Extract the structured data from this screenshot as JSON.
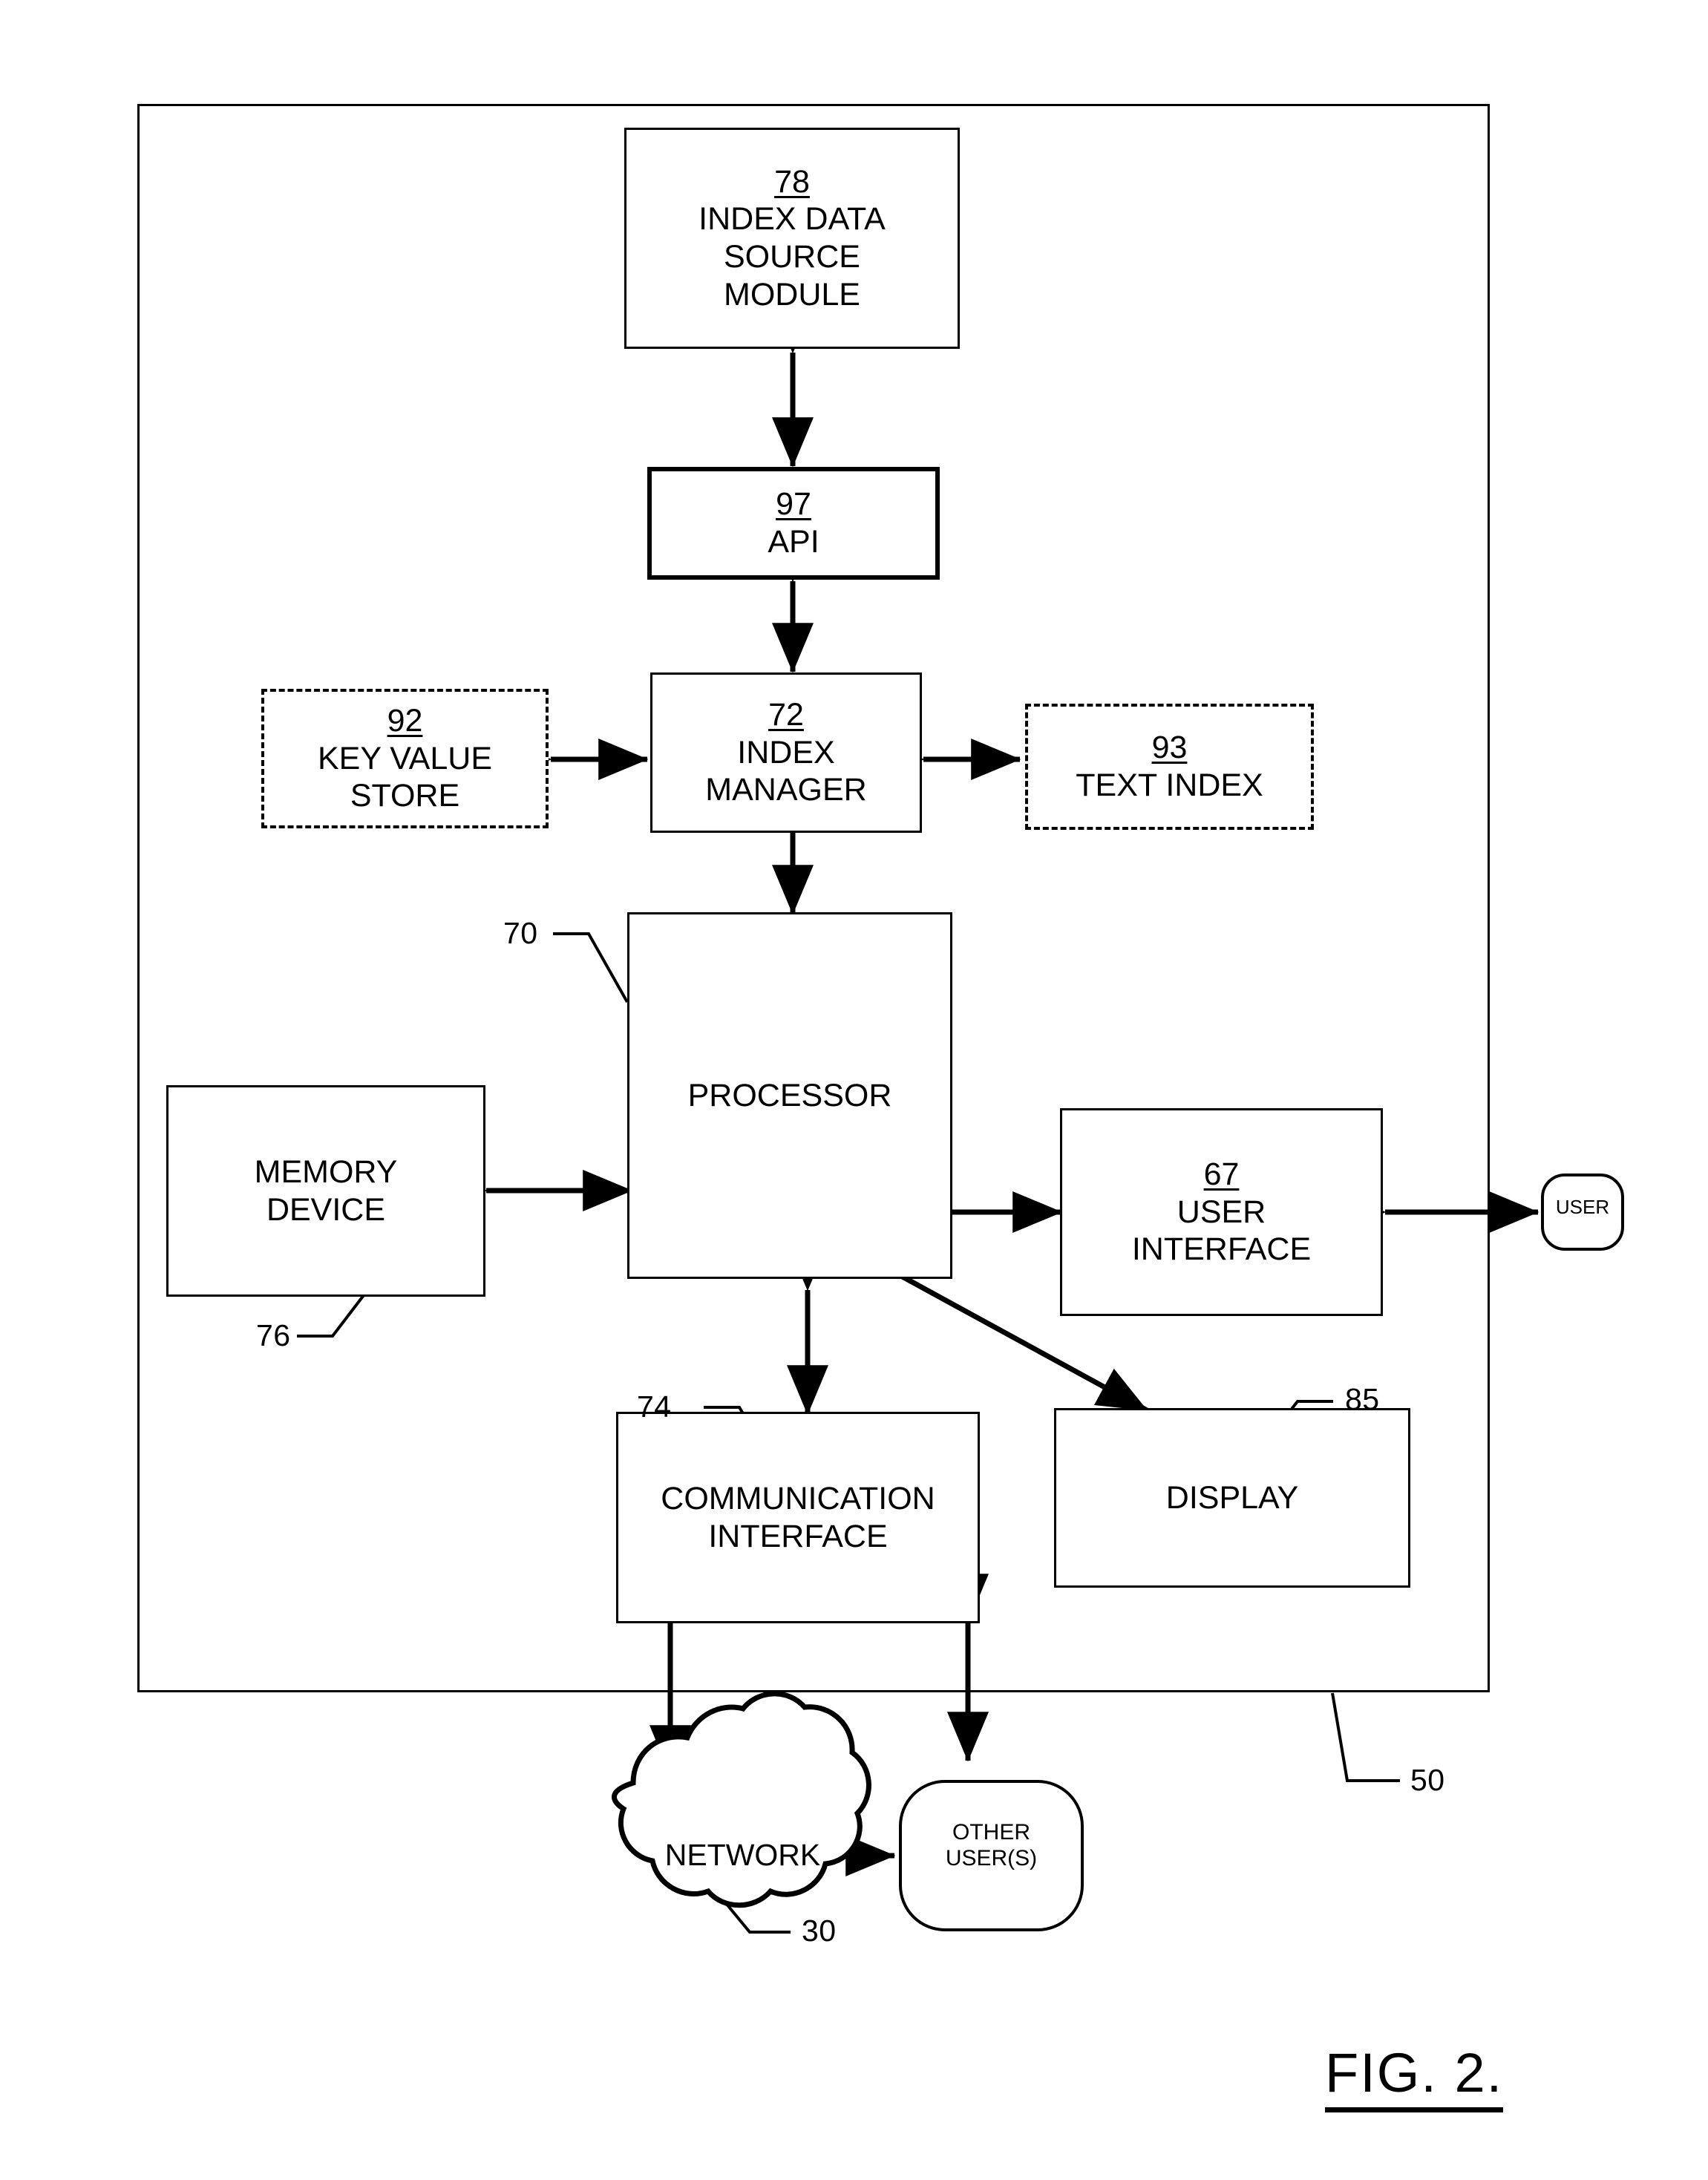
{
  "figure": {
    "caption": "FIG. 2.",
    "container_ref": "50"
  },
  "nodes": {
    "index_data_source": {
      "ref": "78",
      "label": "INDEX DATA\nSOURCE\nMODULE"
    },
    "api": {
      "ref": "97",
      "label": "API"
    },
    "key_value_store": {
      "ref": "92",
      "label": "KEY VALUE\nSTORE"
    },
    "index_manager": {
      "ref": "72",
      "label": "INDEX\nMANAGER"
    },
    "text_index": {
      "ref": "93",
      "label": "TEXT INDEX"
    },
    "processor": {
      "ref": "70",
      "label": "PROCESSOR"
    },
    "memory_device": {
      "ref": "76",
      "label": "MEMORY\nDEVICE"
    },
    "user_interface": {
      "ref": "67",
      "label": "USER\nINTERFACE"
    },
    "communication_interface": {
      "ref": "74",
      "label": "COMMUNICATION\nINTERFACE"
    },
    "display": {
      "ref": "85",
      "label": "DISPLAY"
    },
    "user": {
      "label": "USER"
    },
    "network": {
      "ref": "30",
      "label": "NETWORK"
    },
    "other_users": {
      "label": "OTHER\nUSER(S)"
    }
  },
  "leaders": {
    "processor": "70",
    "memory_device": "76",
    "communication_interface": "74",
    "display": "85",
    "container": "50",
    "network": "30"
  },
  "colors": {
    "stroke": "#000000",
    "background": "#ffffff"
  }
}
